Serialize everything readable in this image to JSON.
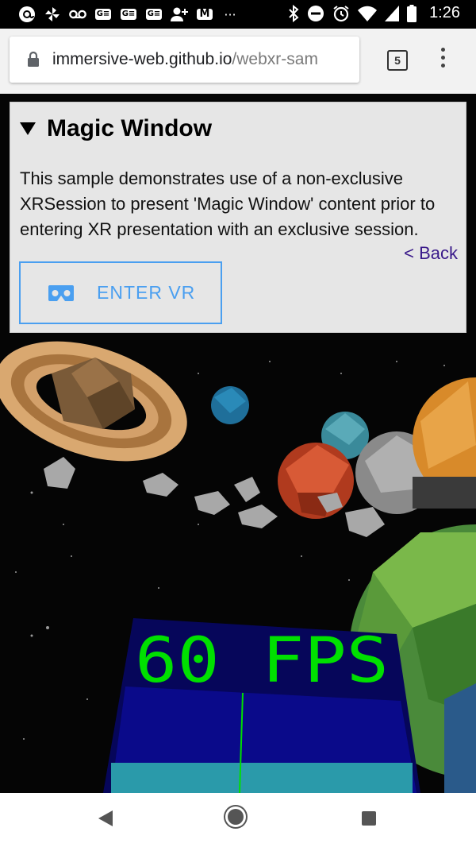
{
  "status_bar": {
    "time": "1:26",
    "left_icons": [
      "at-sign-icon",
      "pinwheel-icon",
      "voicemail-icon",
      "ge-icon",
      "ge-icon",
      "ge-icon",
      "add-person-icon",
      "gmail-icon",
      "more-notifications-icon"
    ],
    "gmail_label": "M",
    "more_label": "···",
    "ge_label": "G≡",
    "right_icons": [
      "bluetooth-icon",
      "do-not-disturb-icon",
      "alarm-icon",
      "wifi-icon",
      "cell-signal-icon",
      "battery-icon"
    ]
  },
  "browser": {
    "url_host": "immersive-web.github.io",
    "url_path": "/webxr-sam",
    "tab_count": "5"
  },
  "panel": {
    "title": "Magic Window",
    "description": "This sample demonstrates use of a non-exclusive XRSession to present 'Magic Window' content prior to entering XR presentation with an exclusive session.",
    "back_link": "< Back",
    "enter_vr_label": "ENTER VR"
  },
  "scene": {
    "fps_text": "60 FPS",
    "colors": {
      "fps": "#00e000",
      "panel": "#0a0a7a",
      "saturn": "#c8945a",
      "red_planet": "#c84a2a",
      "green_planet": "#6aa84a"
    }
  },
  "colors": {
    "accent": "#4a9ff0",
    "link": "#3a1a8a",
    "panel_bg": "#e6e6e6"
  }
}
